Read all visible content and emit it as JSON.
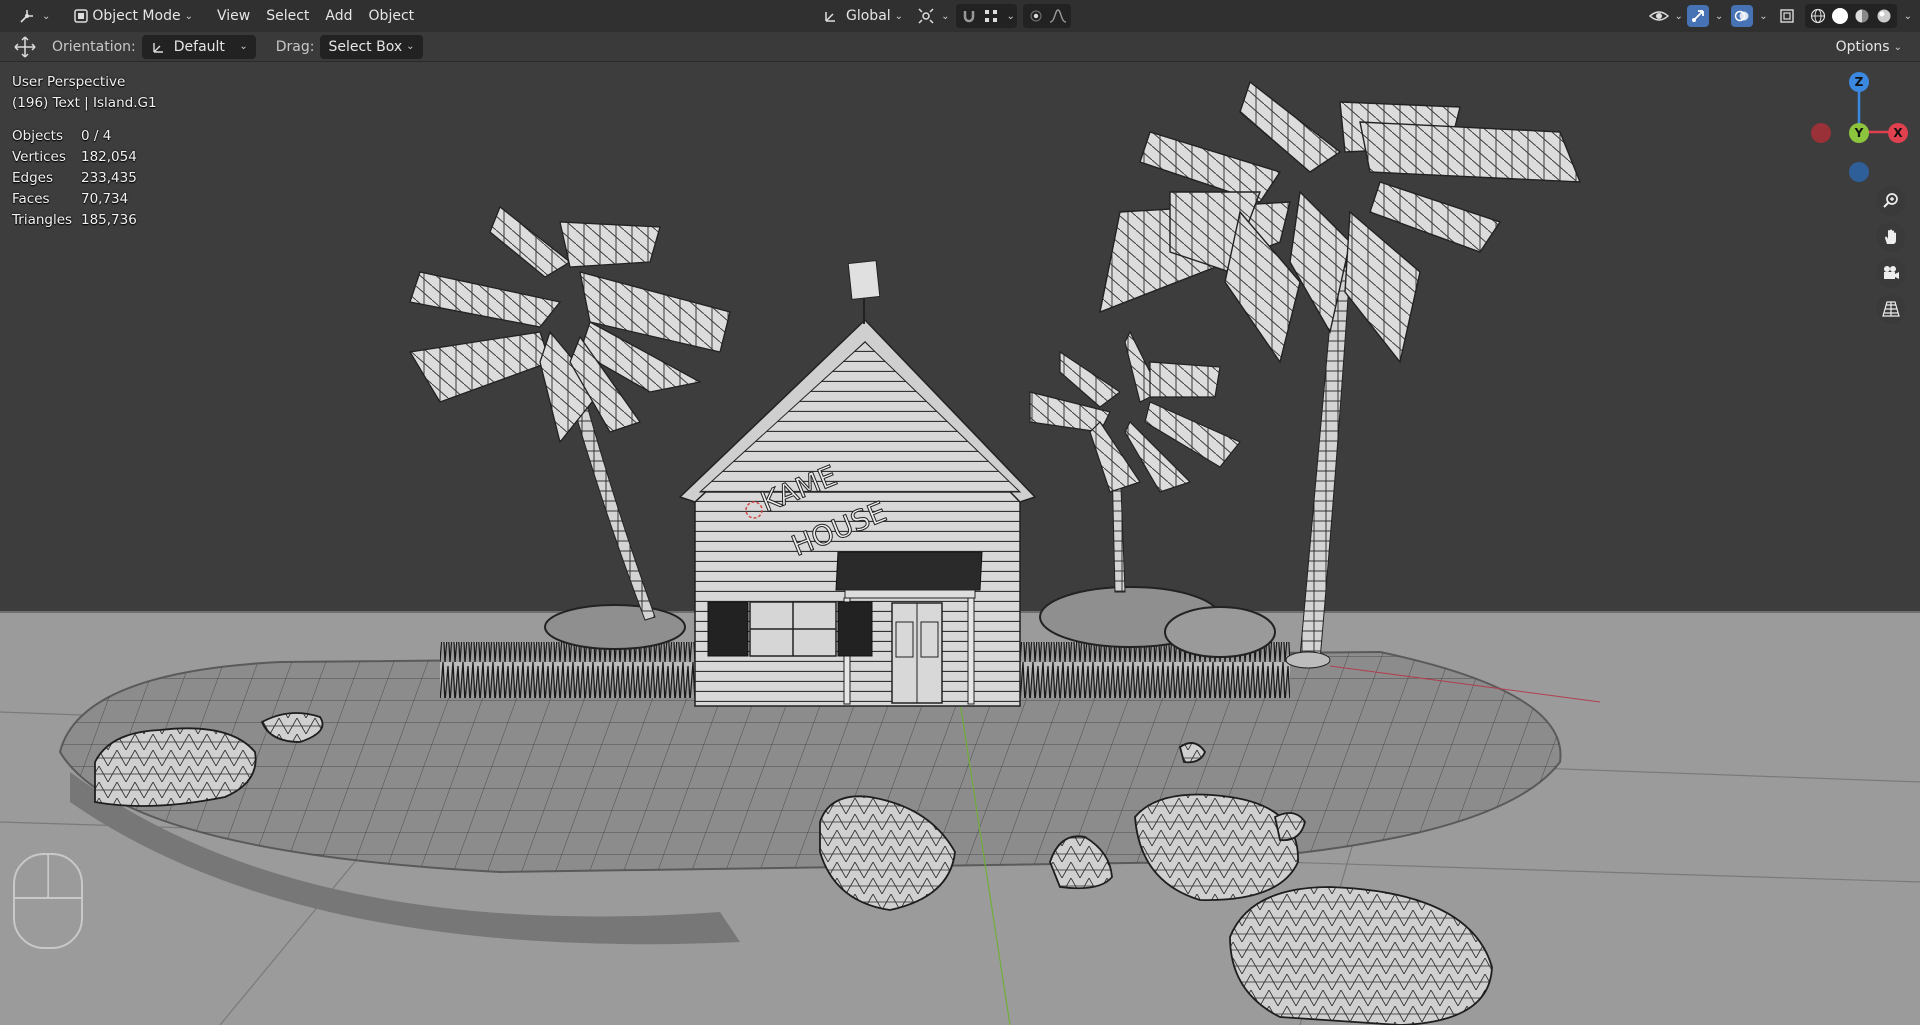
{
  "header": {
    "mode": "Object Mode",
    "menus": [
      "View",
      "Select",
      "Add",
      "Object"
    ],
    "transform_orientation": "Global",
    "icons": {
      "editor_type": "axis-editor-icon",
      "mode": "object-mode-icon",
      "pivot": "pivot-point-icon",
      "snap": "snap-icon",
      "snap_increment": "grid-snap-icon",
      "proportional": "proportional-edit-icon",
      "falloff": "falloff-curve-icon",
      "visibility": "eye-visibility-icon",
      "gizmo": "gizmo-icon",
      "overlays": "overlays-icon",
      "xray": "xray-icon",
      "shading": [
        "wireframe-shading-icon",
        "solid-shading-icon",
        "material-shading-icon",
        "rendered-shading-icon"
      ]
    }
  },
  "toolbar": {
    "orientation_label": "Orientation:",
    "orientation_value": "Default",
    "drag_label": "Drag:",
    "drag_value": "Select Box",
    "options_label": "Options"
  },
  "overlay": {
    "view_name": "User Perspective",
    "object_info": "(196) Text | Island.G1",
    "stats": [
      {
        "key": "Objects",
        "value": "0 / 4"
      },
      {
        "key": "Vertices",
        "value": "182,054"
      },
      {
        "key": "Edges",
        "value": "233,435"
      },
      {
        "key": "Faces",
        "value": "70,734"
      },
      {
        "key": "Triangles",
        "value": "185,736"
      }
    ]
  },
  "gizmo": {
    "z_label": "Z",
    "y_label": "Y",
    "x_label": "X",
    "colors": {
      "x": "#e0414f",
      "y": "#8cc43d",
      "z": "#3b88e0",
      "x_neg": "#9a3038",
      "z_neg": "#2e5f98"
    }
  },
  "nav_buttons": [
    "zoom-icon",
    "pan-hand-icon",
    "camera-icon",
    "perspective-grid-icon"
  ],
  "scene": {
    "house_sign_line1": "KAME",
    "house_sign_line2": "HOUSE",
    "colors": {
      "sky": "#3d3d3d",
      "ground": "#9a9a9a",
      "mesh": "#a8a8a8",
      "wire": "#1c1c1c"
    }
  }
}
